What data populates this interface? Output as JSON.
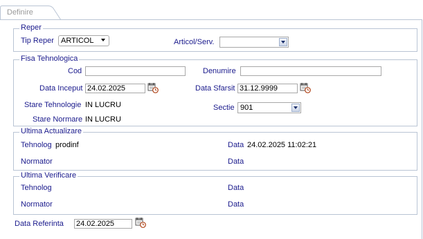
{
  "tab": {
    "label": "Definire"
  },
  "reper": {
    "legend": "Reper",
    "tip_reper_label": "Tip Reper",
    "tip_reper_value": "ARTICOL",
    "articol_label": "Articol/Serv.",
    "articol_value": ""
  },
  "fisa": {
    "legend": "Fisa Tehnologica",
    "cod_label": "Cod",
    "cod_value": "",
    "denumire_label": "Denumire",
    "denumire_value": "",
    "data_inceput_label": "Data Inceput",
    "data_inceput_value": "24.02.2025",
    "data_sfarsit_label": "Data Sfarsit",
    "data_sfarsit_value": "31.12.9999",
    "stare_tehnologie_label": "Stare Tehnologie",
    "stare_tehnologie_value": "IN LUCRU",
    "sectie_label": "Sectie",
    "sectie_value": "901",
    "stare_normare_label": "Stare Normare",
    "stare_normare_value": "IN LUCRU"
  },
  "actualizare": {
    "legend": "Ultima Actualizare",
    "tehnolog_label": "Tehnolog",
    "tehnolog_value": "prodinf",
    "data1_label": "Data",
    "data1_value": "24.02.2025 11:02:21",
    "normator_label": "Normator",
    "data2_label": "Data"
  },
  "verificare": {
    "legend": "Ultima Verificare",
    "tehnolog_label": "Tehnolog",
    "data1_label": "Data",
    "normator_label": "Normator",
    "data2_label": "Data"
  },
  "referinta": {
    "label": "Data Referinta",
    "value": "24.02.2025"
  },
  "icons": {
    "calendar": "calendar-clock-icon",
    "dropdown": "chevron-down-icon"
  },
  "colors": {
    "label": "#1a1a8c",
    "border": "#b9c4d4"
  }
}
